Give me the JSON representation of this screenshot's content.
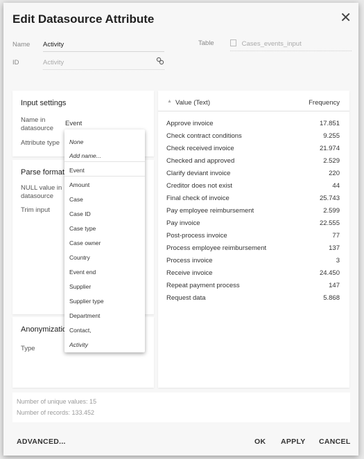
{
  "dialog": {
    "title": "Edit Datasource Attribute",
    "close_glyph": "✕"
  },
  "fields": {
    "name": {
      "label": "Name",
      "value": "Activity"
    },
    "id": {
      "label": "ID",
      "value": "Activity"
    },
    "table": {
      "label": "Table",
      "value": "Cases_events_input"
    }
  },
  "input_settings": {
    "title": "Input settings",
    "name_in_datasource_label": "Name in datasource",
    "name_in_datasource_value": "Event",
    "attribute_type_label": "Attribute type"
  },
  "parse_format": {
    "title": "Parse format",
    "null_value_label": "NULL value in datasource",
    "trim_input_label": "Trim input"
  },
  "anonymization": {
    "title": "Anonymization",
    "type_label": "Type"
  },
  "dropdown": {
    "items": [
      "None",
      "Add name...",
      "Event",
      "Amount",
      "Case",
      "Case ID",
      "Case type",
      "Case owner",
      "Country",
      "Event end",
      "Supplier",
      "Supplier type",
      "Department",
      "Contact,",
      "Activity"
    ]
  },
  "table": {
    "col_value": "Value (Text)",
    "col_frequency": "Frequency",
    "rows": [
      {
        "value": "Approve invoice",
        "freq": "17.851"
      },
      {
        "value": "Check contract conditions",
        "freq": "9.255"
      },
      {
        "value": "Check received invoice",
        "freq": "21.974"
      },
      {
        "value": "Checked and approved",
        "freq": "2.529"
      },
      {
        "value": "Clarify deviant invoice",
        "freq": "220"
      },
      {
        "value": "Creditor does not exist",
        "freq": "44"
      },
      {
        "value": "Final check of invoice",
        "freq": "25.743"
      },
      {
        "value": "Pay employee reimbursement",
        "freq": "2.599"
      },
      {
        "value": "Pay invoice",
        "freq": "22.555"
      },
      {
        "value": "Post-process invoice",
        "freq": "77"
      },
      {
        "value": "Process employee reimbursement",
        "freq": "137"
      },
      {
        "value": "Process invoice",
        "freq": "3"
      },
      {
        "value": "Receive invoice",
        "freq": "24.450"
      },
      {
        "value": "Repeat payment process",
        "freq": "147"
      },
      {
        "value": "Request data",
        "freq": "5.868"
      }
    ]
  },
  "stats": {
    "unique_values": "Number of unique values: 15",
    "records": "Number of records: 133.452"
  },
  "footer": {
    "advanced": "ADVANCED...",
    "ok": "OK",
    "apply": "APPLY",
    "cancel": "CANCEL"
  }
}
